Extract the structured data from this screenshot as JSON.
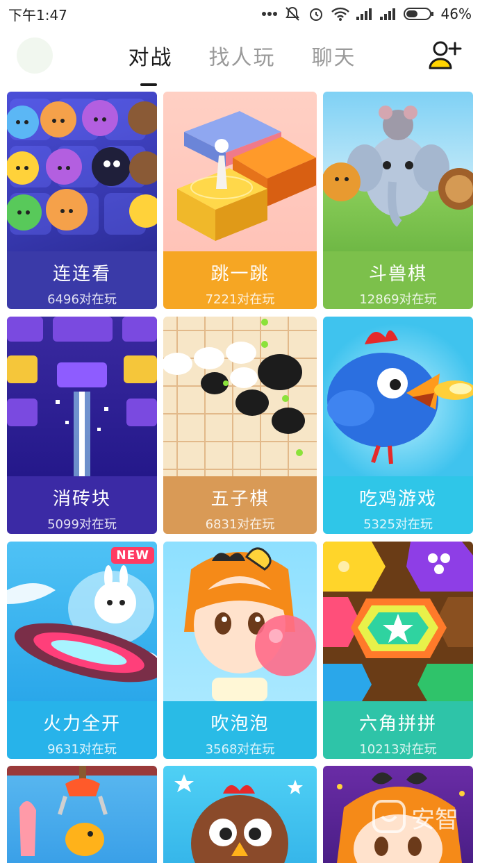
{
  "status": {
    "time": "下午1:47",
    "battery": "46%"
  },
  "tabs": [
    {
      "label": "对战",
      "active": true
    },
    {
      "label": "找人玩",
      "active": false
    },
    {
      "label": "聊天",
      "active": false
    }
  ],
  "games": [
    {
      "name": "连连看",
      "players": "6496对在玩",
      "caption_color": "#3a3aa8",
      "icon": "cats-match-art"
    },
    {
      "name": "跳一跳",
      "players": "7221对在玩",
      "caption_color": "#f6a623",
      "icon": "jump-art"
    },
    {
      "name": "斗兽棋",
      "players": "12869对在玩",
      "caption_color": "#7cc04b",
      "icon": "animals-art"
    },
    {
      "name": "消砖块",
      "players": "5099对在玩",
      "caption_color": "#3b2aa5",
      "icon": "bricks-art"
    },
    {
      "name": "五子棋",
      "players": "6831对在玩",
      "caption_color": "#d99a56",
      "icon": "gomoku-art"
    },
    {
      "name": "吃鸡游戏",
      "players": "5325对在玩",
      "caption_color": "#2fc6e8",
      "icon": "chicken-art"
    },
    {
      "name": "火力全开",
      "players": "9631对在玩",
      "caption_color": "#27b3ea",
      "icon": "ufo-art",
      "badge": "NEW"
    },
    {
      "name": "吹泡泡",
      "players": "3568对在玩",
      "caption_color": "#29bbe6",
      "icon": "bubble-girl-art"
    },
    {
      "name": "六角拼拼",
      "players": "10213对在玩",
      "caption_color": "#2ec4a8",
      "icon": "hexagon-art"
    }
  ],
  "watermark": {
    "text": "安智"
  }
}
